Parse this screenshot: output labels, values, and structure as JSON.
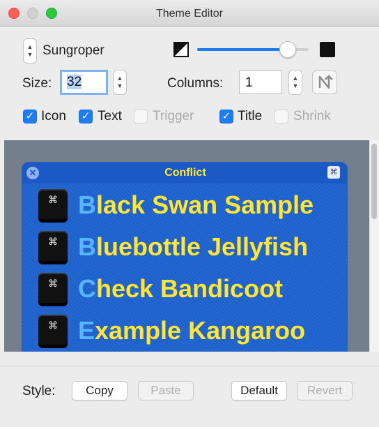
{
  "window": {
    "title": "Theme Editor"
  },
  "theme": {
    "name": "Sungroper"
  },
  "size": {
    "label": "Size:",
    "value": "32"
  },
  "columns": {
    "label": "Columns:",
    "value": "1"
  },
  "slider": {
    "value": 0.81,
    "accent": "#1e7cf5"
  },
  "options": [
    {
      "label": "Icon",
      "checked": true,
      "enabled": true
    },
    {
      "label": "Text",
      "checked": true,
      "enabled": true
    },
    {
      "label": "Trigger",
      "checked": false,
      "enabled": false
    },
    {
      "label": "Title",
      "checked": true,
      "enabled": true
    },
    {
      "label": "Shrink",
      "checked": false,
      "enabled": false
    }
  ],
  "preview": {
    "title": "Conflict",
    "key_glyph": "⌘",
    "items": [
      {
        "first": "B",
        "rest": "lack Swan Sample"
      },
      {
        "first": "B",
        "rest": "luebottle Jellyfish"
      },
      {
        "first": "C",
        "rest": "heck Bandicoot"
      },
      {
        "first": "E",
        "rest": "xample Kangaroo"
      }
    ],
    "colors": {
      "background": "#1f63d1",
      "text": "#ffe632",
      "highlight": "#56b6ff"
    }
  },
  "style_bar": {
    "label": "Style:",
    "copy": "Copy",
    "paste": "Paste",
    "default": "Default",
    "revert": "Revert"
  }
}
